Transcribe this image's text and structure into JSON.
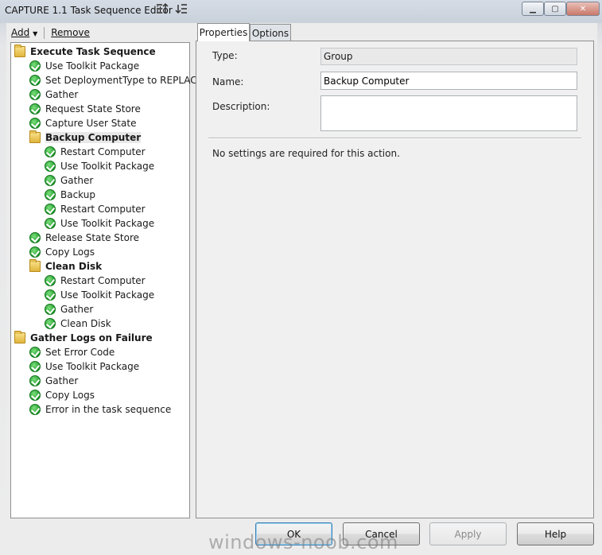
{
  "window": {
    "title": "CAPTURE 1.1 Task Sequence Editor"
  },
  "toolbar": {
    "add_label": "Add",
    "remove_label": "Remove"
  },
  "tree": {
    "items": [
      {
        "label": "Execute Task Sequence",
        "type": "group"
      },
      {
        "label": "Use Toolkit Package",
        "type": "step"
      },
      {
        "label": "Set DeploymentType to REPLACE",
        "type": "step"
      },
      {
        "label": "Gather",
        "type": "step"
      },
      {
        "label": "Request State Store",
        "type": "step"
      },
      {
        "label": "Capture User State",
        "type": "step"
      },
      {
        "label": "Backup Computer",
        "type": "group",
        "selected": true
      },
      {
        "label": "Restart Computer",
        "type": "step"
      },
      {
        "label": "Use Toolkit Package",
        "type": "step"
      },
      {
        "label": "Gather",
        "type": "step"
      },
      {
        "label": "Backup",
        "type": "step"
      },
      {
        "label": "Restart Computer",
        "type": "step"
      },
      {
        "label": "Use Toolkit Package",
        "type": "step"
      },
      {
        "label": "Release State Store",
        "type": "step"
      },
      {
        "label": "Copy Logs",
        "type": "step"
      },
      {
        "label": "Clean Disk",
        "type": "group"
      },
      {
        "label": "Restart Computer",
        "type": "step"
      },
      {
        "label": "Use Toolkit Package",
        "type": "step"
      },
      {
        "label": "Gather",
        "type": "step"
      },
      {
        "label": "Clean Disk",
        "type": "step"
      },
      {
        "label": "Gather Logs on Failure",
        "type": "group"
      },
      {
        "label": "Set Error Code",
        "type": "step"
      },
      {
        "label": "Use Toolkit Package",
        "type": "step"
      },
      {
        "label": "Gather",
        "type": "step"
      },
      {
        "label": "Copy Logs",
        "type": "step"
      },
      {
        "label": "Error in the task sequence",
        "type": "step"
      }
    ]
  },
  "tabs": [
    {
      "label": "Properties",
      "active": true
    },
    {
      "label": "Options",
      "active": false
    }
  ],
  "properties": {
    "type_label": "Type:",
    "type_value": "Group",
    "name_label": "Name:",
    "name_value": "Backup Computer",
    "description_label": "Description:",
    "description_value": "",
    "note": "No settings are required  for this action."
  },
  "buttons": {
    "ok": "OK",
    "cancel": "Cancel",
    "apply": "Apply",
    "help": "Help"
  },
  "watermark": "windows-noob.com",
  "colors": {
    "status_check": "#1f9a2b",
    "folder": "#e0b53c",
    "default_button_border": "#3c7fb1"
  }
}
